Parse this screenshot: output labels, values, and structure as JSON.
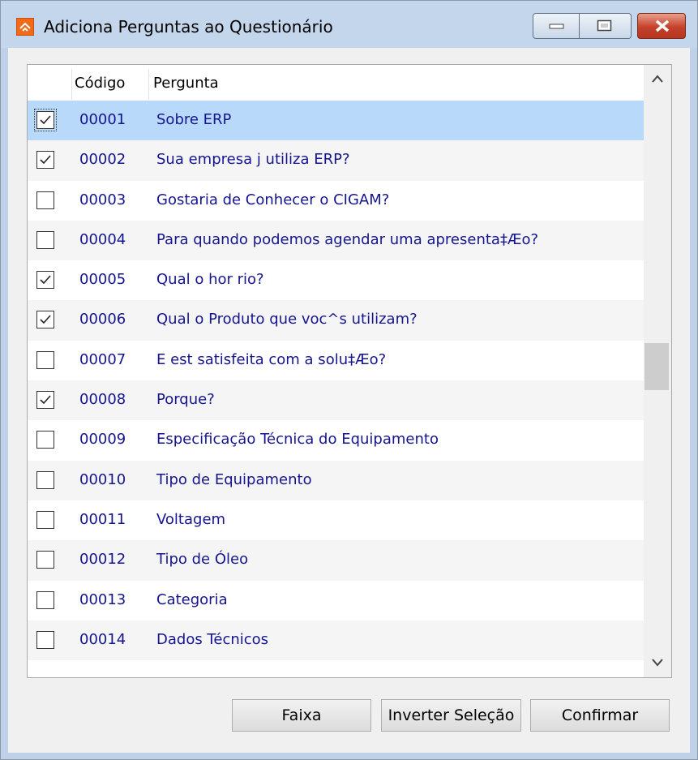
{
  "window": {
    "title": "Adiciona Perguntas ao Questionário",
    "minimize_label": "minimize",
    "maximize_label": "maximize",
    "close_label": "close"
  },
  "grid": {
    "columns": [
      "",
      "Código",
      "Pergunta"
    ],
    "rows": [
      {
        "checked": true,
        "code": "00001",
        "question": "Sobre ERP",
        "selected": true
      },
      {
        "checked": true,
        "code": "00002",
        "question": "Sua empresa j  utiliza ERP?"
      },
      {
        "checked": false,
        "code": "00003",
        "question": "Gostaria de Conhecer o CIGAM?"
      },
      {
        "checked": false,
        "code": "00004",
        "question": "Para quando podemos agendar uma apresenta‡Æo?"
      },
      {
        "checked": true,
        "code": "00005",
        "question": "Qual o hor rio?"
      },
      {
        "checked": true,
        "code": "00006",
        "question": "Qual o Produto que voc^s utilizam?"
      },
      {
        "checked": false,
        "code": "00007",
        "question": "E est  satisfeita com a solu‡Æo?"
      },
      {
        "checked": true,
        "code": "00008",
        "question": "Porque?"
      },
      {
        "checked": false,
        "code": "00009",
        "question": "Especificação Técnica do Equipamento"
      },
      {
        "checked": false,
        "code": "00010",
        "question": "Tipo de Equipamento"
      },
      {
        "checked": false,
        "code": "00011",
        "question": "Voltagem"
      },
      {
        "checked": false,
        "code": "00012",
        "question": "Tipo de Óleo"
      },
      {
        "checked": false,
        "code": "00013",
        "question": "Categoria"
      },
      {
        "checked": false,
        "code": "00014",
        "question": "Dados Técnicos"
      }
    ]
  },
  "buttons": {
    "faixa": "Faixa",
    "inverter": "Inverter Seleção",
    "confirmar": "Confirmar"
  },
  "icons": {
    "scroll_up": "chevron-up-icon",
    "scroll_down": "chevron-down-icon"
  }
}
